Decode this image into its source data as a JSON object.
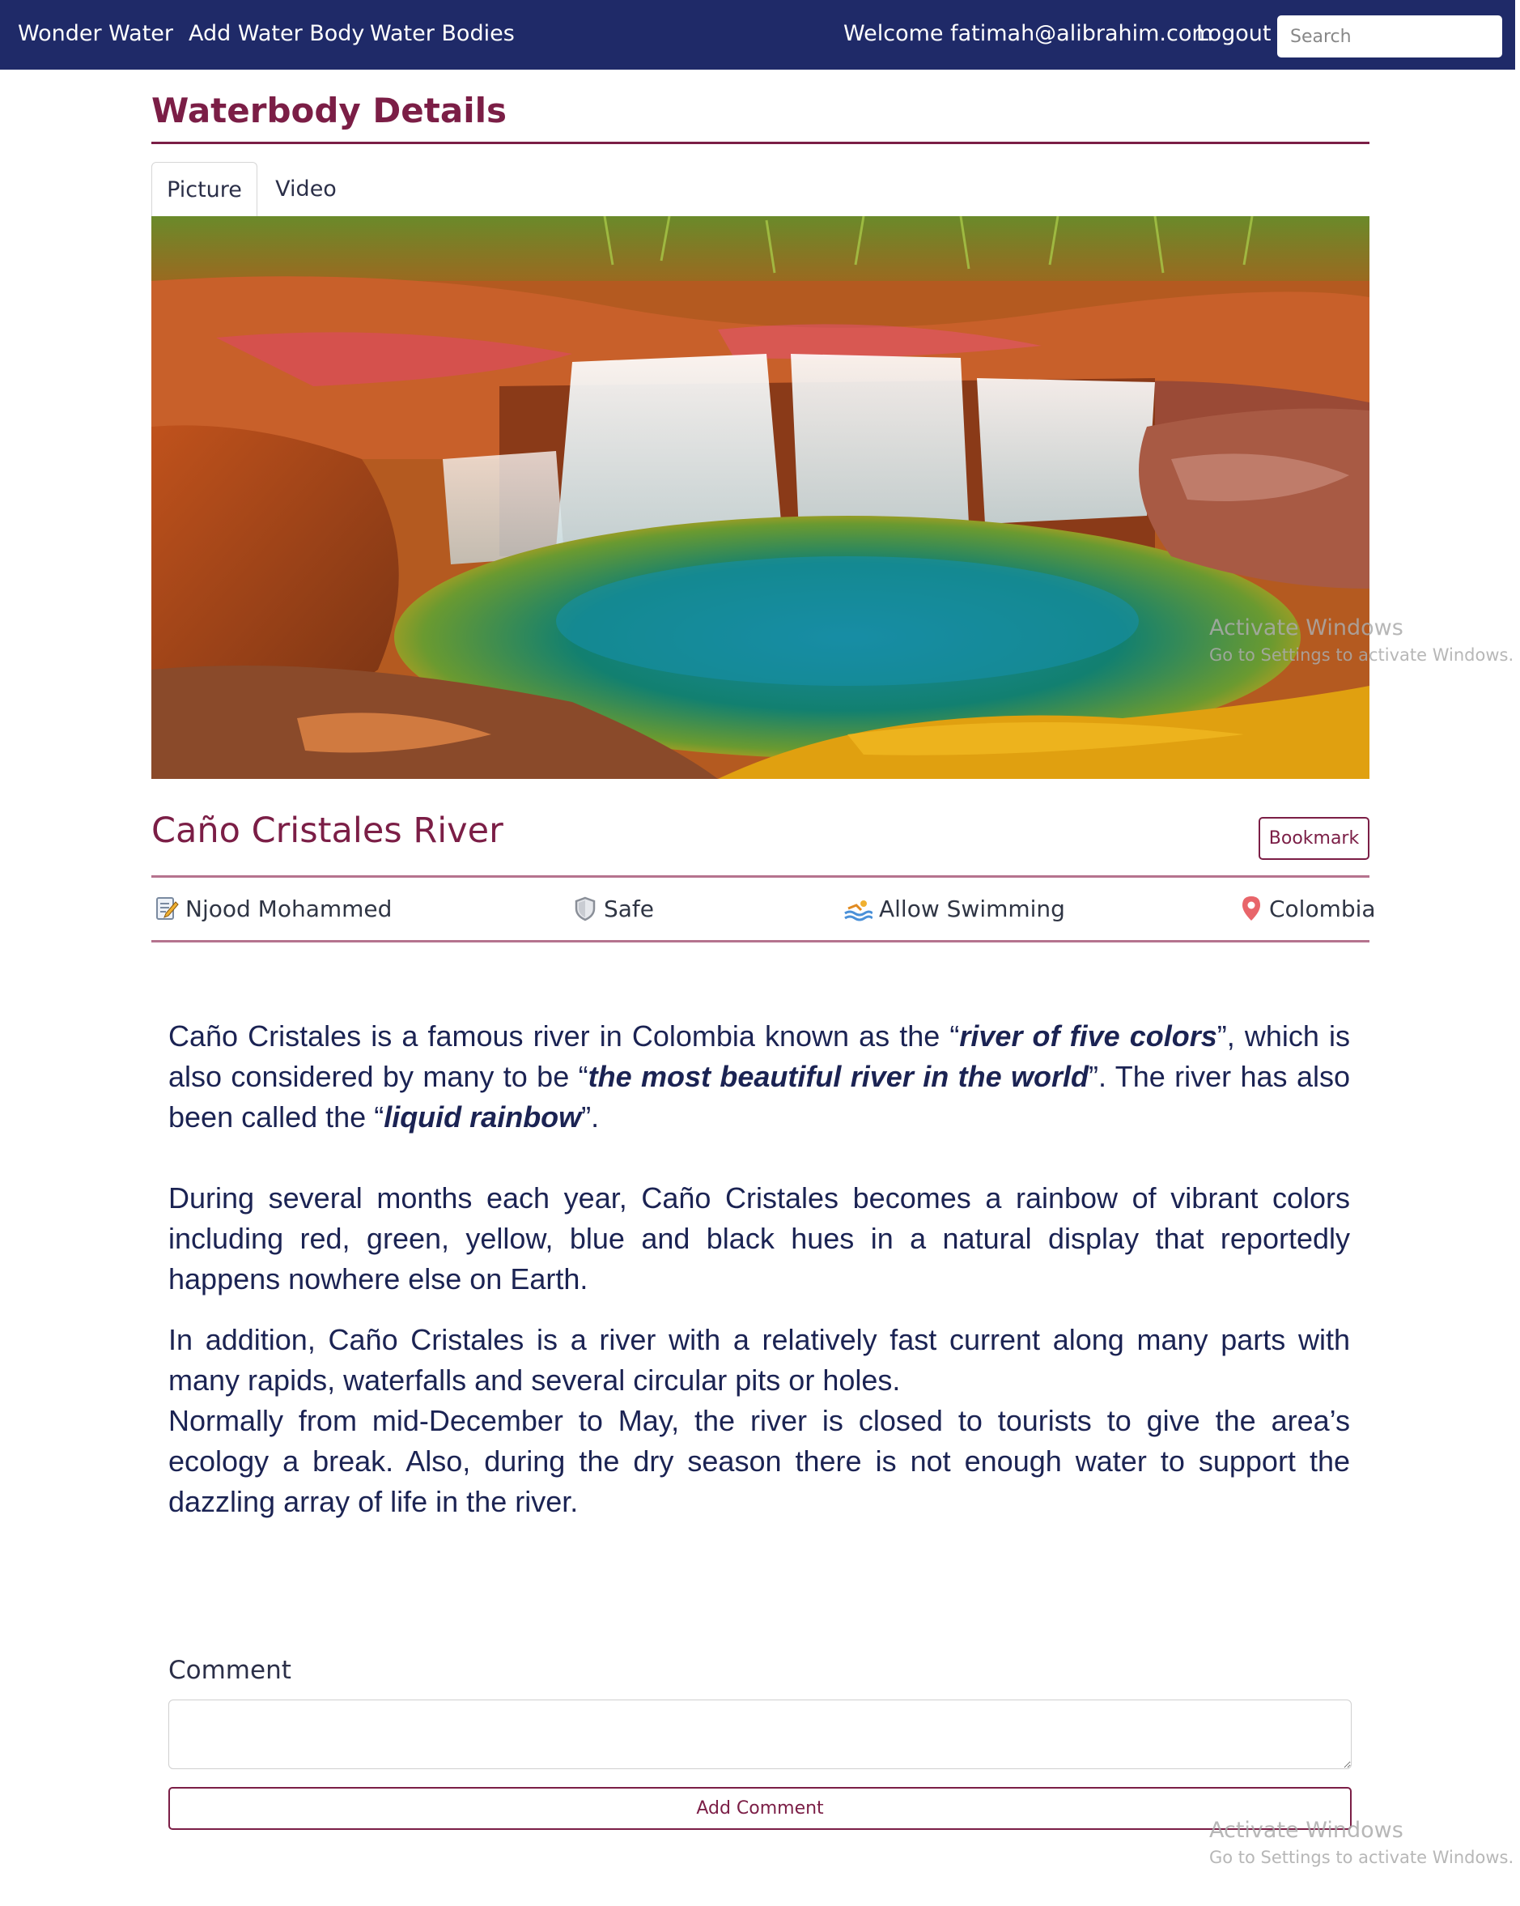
{
  "navbar": {
    "brand": "Wonder Water",
    "links": [
      "Add Water Body",
      "Water Bodies"
    ],
    "welcome": "Welcome fatimah@alibrahim.com",
    "logout": "Logout",
    "search_placeholder": "Search"
  },
  "page": {
    "title": "Waterbody Details",
    "tabs": [
      "Picture",
      "Video"
    ],
    "active_tab": "Picture"
  },
  "waterbody": {
    "name": "Caño Cristales River",
    "bookmark_label": "Bookmark",
    "info": {
      "author": "Njood Mohammed",
      "safety": "Safe",
      "swimming": "Allow Swimming",
      "location": "Colombia"
    },
    "description": {
      "p1": {
        "t1": "Caño Cristales is a famous river in Colombia known as the “",
        "b1": "river of five colors",
        "t2": "”, which is also considered by many to be “",
        "b2": "the most beautiful river in the world",
        "t3": "”. The river has also been called the “",
        "b3": "liquid rainbow",
        "t4": "”."
      },
      "p2": "During several months each year, Caño Cristales becomes a rainbow of vibrant colors including red, green, yellow, blue and black hues in a natural display that reportedly happens nowhere else on Earth.",
      "p3": "In addition, Caño Cristales is a river with a relatively fast current along many parts with many rapids, waterfalls and several circular pits or holes.",
      "p4": "Normally from mid-December to May, the river is closed to tourists to give the area’s ecology a break. Also, during the dry season there is not enough water to support the dazzling array of life in the river."
    }
  },
  "comment": {
    "label": "Comment",
    "value": "",
    "button_label": "Add Comment"
  },
  "watermark": {
    "title": "Activate Windows",
    "subtitle": "Go to Settings to activate Windows."
  },
  "icons": {
    "author": "edit-note-icon",
    "safety": "shield-icon",
    "swimming": "swimming-icon",
    "location": "map-pin-icon"
  },
  "colors": {
    "navbar_bg": "#1f2a68",
    "accent": "#7b1e46",
    "text_dark": "#1b2353"
  }
}
